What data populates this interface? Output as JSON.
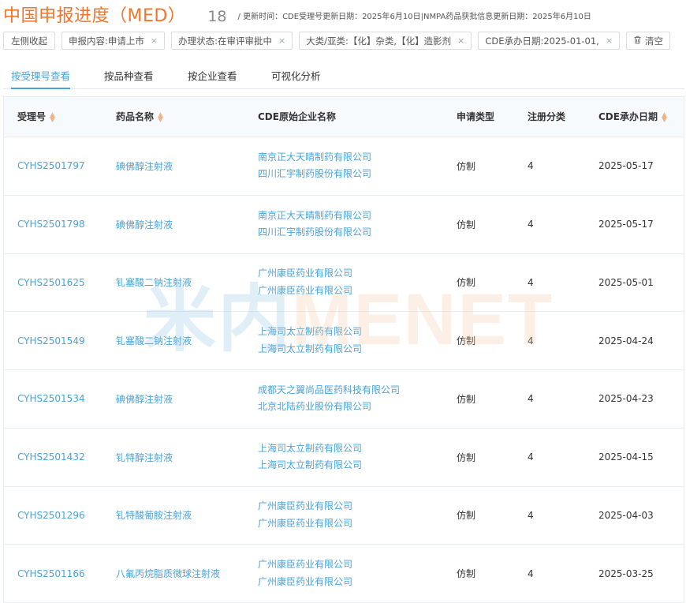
{
  "header": {
    "title": "中国申报进度（MED）",
    "count": "18",
    "updated": "/ 更新时间：CDE受理号更新日期：2025年6月10日|NMPA药品获批信息更新日期：2025年6月10日"
  },
  "filters": {
    "collapse_label": "左侧收起",
    "chips": [
      {
        "label": "申报内容:申请上市"
      },
      {
        "label": "办理状态:在审评审批中"
      },
      {
        "label": "大类/亚类:【化】杂类,【化】造影剂"
      },
      {
        "label": "CDE承办日期:2025-01-01,"
      }
    ],
    "close_glyph": "×",
    "clear_label": "清空"
  },
  "tabs": [
    {
      "label": "按受理号查看",
      "active": true
    },
    {
      "label": "按品种查看",
      "active": false
    },
    {
      "label": "按企业查看",
      "active": false
    },
    {
      "label": "可视化分析",
      "active": false
    }
  ],
  "table": {
    "columns": [
      "受理号",
      "药品名称",
      "CDE原始企业名称",
      "申请类型",
      "注册分类",
      "CDE承办日期"
    ],
    "rows": [
      {
        "id": "CYHS2501797",
        "drug": "碘佛醇注射液",
        "companies": [
          "南京正大天晴制药有限公司",
          "四川汇宇制药股份有限公司"
        ],
        "type": "仿制",
        "class": "4",
        "date": "2025-05-17"
      },
      {
        "id": "CYHS2501798",
        "drug": "碘佛醇注射液",
        "companies": [
          "南京正大天晴制药有限公司",
          "四川汇宇制药股份有限公司"
        ],
        "type": "仿制",
        "class": "4",
        "date": "2025-05-17"
      },
      {
        "id": "CYHS2501625",
        "drug": "钆塞酸二钠注射液",
        "companies": [
          "广州康臣药业有限公司",
          "广州康臣药业有限公司"
        ],
        "type": "仿制",
        "class": "4",
        "date": "2025-05-01"
      },
      {
        "id": "CYHS2501549",
        "drug": "钆塞酸二钠注射液",
        "companies": [
          "上海司太立制药有限公司",
          "上海司太立制药有限公司"
        ],
        "type": "仿制",
        "class": "4",
        "date": "2025-04-24"
      },
      {
        "id": "CYHS2501534",
        "drug": "碘佛醇注射液",
        "companies": [
          "成都天之翼尚品医药科技有限公司",
          "北京北陆药业股份有限公司"
        ],
        "type": "仿制",
        "class": "4",
        "date": "2025-04-23"
      },
      {
        "id": "CYHS2501432",
        "drug": "钆特醇注射液",
        "companies": [
          "上海司太立制药有限公司",
          "上海司太立制药有限公司"
        ],
        "type": "仿制",
        "class": "4",
        "date": "2025-04-15"
      },
      {
        "id": "CYHS2501296",
        "drug": "钆特酸葡胺注射液",
        "companies": [
          "广州康臣药业有限公司",
          "广州康臣药业有限公司"
        ],
        "type": "仿制",
        "class": "4",
        "date": "2025-04-03"
      },
      {
        "id": "CYHS2501166",
        "drug": "八氟丙烷脂质微球注射液",
        "companies": [
          "广州康臣药业有限公司",
          "广州康臣药业有限公司"
        ],
        "type": "仿制",
        "class": "4",
        "date": "2025-03-25"
      }
    ]
  },
  "watermark": {
    "cn": "米内",
    "en": "MENET"
  },
  "colors": {
    "title": "#f2762a",
    "link": "#4aa3d8",
    "sort": "#f0b489"
  }
}
